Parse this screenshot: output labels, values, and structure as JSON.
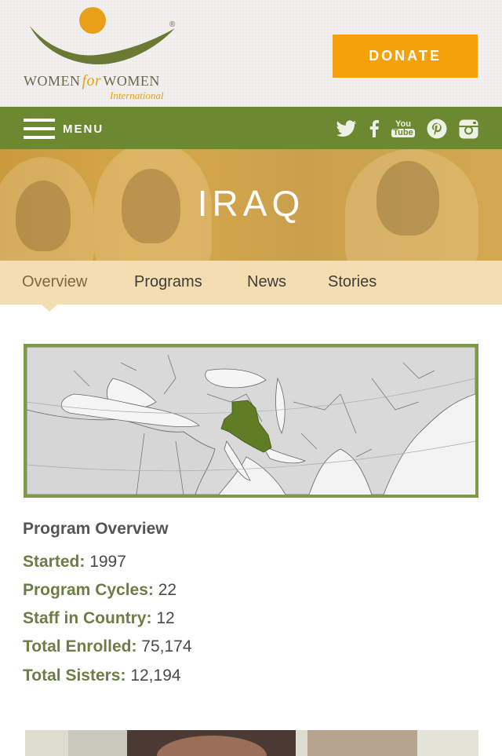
{
  "header": {
    "logo_name_left": "WOMEN",
    "logo_name_for": "for",
    "logo_name_right": "WOMEN",
    "logo_subtitle": "International",
    "logo_reg": "®",
    "donate_label": "DONATE"
  },
  "nav": {
    "menu_label": "MENU",
    "social_icons": [
      "twitter-icon",
      "facebook-icon",
      "youtube-icon",
      "pinterest-icon",
      "instagram-icon"
    ],
    "youtube_text_top": "You",
    "youtube_text_bottom": "Tube"
  },
  "hero": {
    "title": "IRAQ"
  },
  "tabs": [
    {
      "label": "Overview",
      "active": true
    },
    {
      "label": "Programs",
      "active": false
    },
    {
      "label": "News",
      "active": false
    },
    {
      "label": "Stories",
      "active": false
    }
  ],
  "overview": {
    "title": "Program Overview",
    "stats": [
      {
        "label": "Started:",
        "value": "1997"
      },
      {
        "label": "Program Cycles:",
        "value": "22"
      },
      {
        "label": "Staff in Country:",
        "value": "12"
      },
      {
        "label": "Total Enrolled:",
        "value": "75,174"
      },
      {
        "label": "Total Sisters:",
        "value": "12,194"
      }
    ]
  },
  "colors": {
    "brand_green": "#6c8931",
    "donate_orange": "#f5a20a",
    "hero_gold": "#d0a247",
    "tab_bg": "#f4ddb0",
    "map_highlight": "#5e7d24",
    "stat_label": "#6c7d45"
  }
}
